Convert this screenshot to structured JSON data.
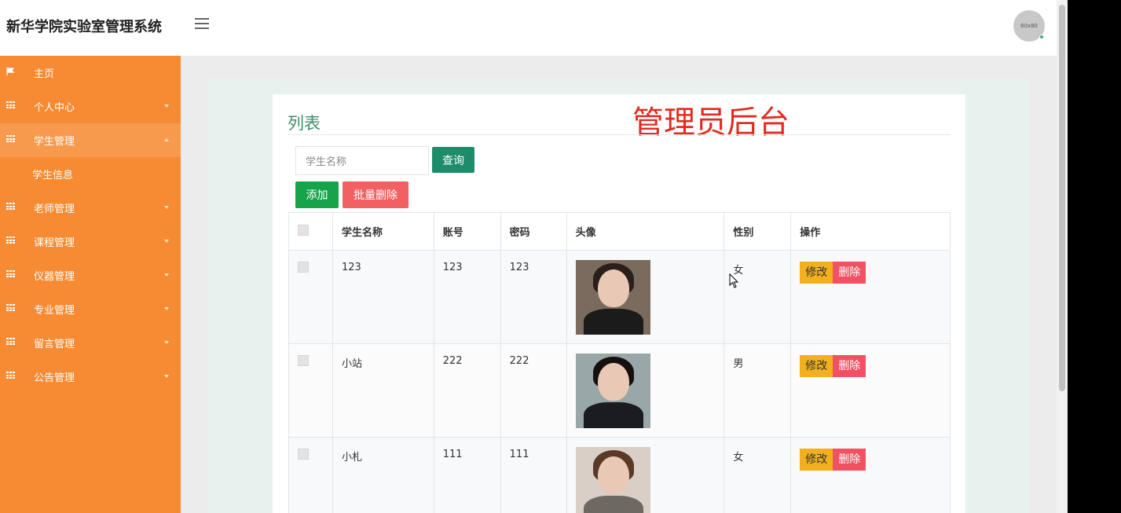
{
  "header": {
    "title": "新华学院实验室管理系统",
    "avatar_text": "80x80"
  },
  "sidebar": {
    "items": [
      {
        "label": "主页",
        "icon": "flag-icon"
      },
      {
        "label": "个人中心",
        "icon": "grid-icon"
      },
      {
        "label": "学生管理",
        "icon": "grid-icon"
      },
      {
        "label": "学生信息"
      },
      {
        "label": "老师管理",
        "icon": "grid-icon"
      },
      {
        "label": "课程管理",
        "icon": "grid-icon"
      },
      {
        "label": "仪器管理",
        "icon": "grid-icon"
      },
      {
        "label": "专业管理",
        "icon": "grid-icon"
      },
      {
        "label": "留言管理",
        "icon": "grid-icon"
      },
      {
        "label": "公告管理",
        "icon": "grid-icon"
      }
    ]
  },
  "main": {
    "title": "列表",
    "watermark": "管理员后台",
    "search": {
      "placeholder": "学生名称"
    },
    "buttons": {
      "query": "查询",
      "add": "添加",
      "batch_delete": "批量删除"
    },
    "table": {
      "headers": [
        "学生名称",
        "账号",
        "密码",
        "头像",
        "性别",
        "操作"
      ],
      "rows": [
        {
          "name": "123",
          "account": "123",
          "password": "123",
          "gender": "女"
        },
        {
          "name": "小站",
          "account": "222",
          "password": "222",
          "gender": "男"
        },
        {
          "name": "小札",
          "account": "111",
          "password": "111",
          "gender": "女"
        }
      ],
      "actions": {
        "edit": "修改",
        "delete": "删除"
      }
    }
  },
  "colors": {
    "sidebar": "#f68b33",
    "title": "#3e8e6a",
    "watermark": "#e22a20",
    "query": "#1e8c6a",
    "add": "#16a34a",
    "batch": "#f26062",
    "edit": "#f2b01e",
    "delete": "#f25063"
  }
}
